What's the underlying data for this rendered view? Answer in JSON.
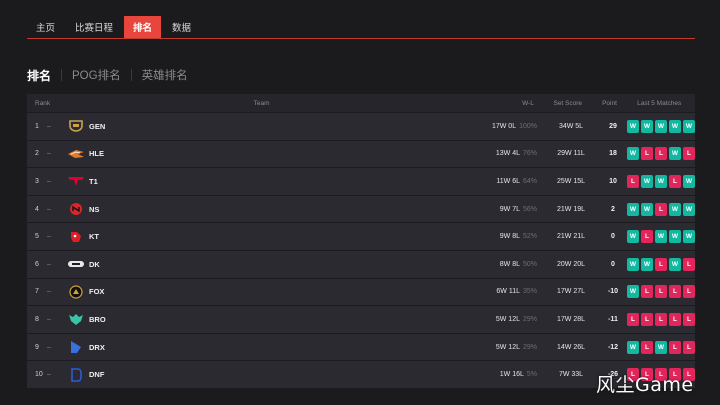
{
  "nav": {
    "items": [
      {
        "label": "主页",
        "active": false
      },
      {
        "label": "比赛日程",
        "active": false
      },
      {
        "label": "排名",
        "active": true
      },
      {
        "label": "数据",
        "active": false
      }
    ]
  },
  "subtabs": [
    "排名",
    "POG排名",
    "英雄排名"
  ],
  "table": {
    "headers": {
      "rank": "Rank",
      "team": "Team",
      "wl": "W-L",
      "set": "Set Score",
      "point": "Point",
      "last5": "Last 5 Matches"
    },
    "rows": [
      {
        "rank": "1",
        "team": "GEN",
        "wl": "17W 0L",
        "pct": "100%",
        "set": "34W 5L",
        "point": "29",
        "last5": [
          "W",
          "W",
          "W",
          "W",
          "W"
        ],
        "logo_color": "#c9a44c"
      },
      {
        "rank": "2",
        "team": "HLE",
        "wl": "13W 4L",
        "pct": "76%",
        "set": "29W 11L",
        "point": "18",
        "last5": [
          "W",
          "L",
          "L",
          "W",
          "L"
        ],
        "logo_color": "#e07a2e"
      },
      {
        "rank": "3",
        "team": "T1",
        "wl": "11W 6L",
        "pct": "64%",
        "set": "25W 15L",
        "point": "10",
        "last5": [
          "L",
          "W",
          "W",
          "L",
          "W"
        ],
        "logo_color": "#e2012d"
      },
      {
        "rank": "4",
        "team": "NS",
        "wl": "9W 7L",
        "pct": "56%",
        "set": "21W 19L",
        "point": "2",
        "last5": [
          "W",
          "W",
          "L",
          "W",
          "W"
        ],
        "logo_color": "#d9262b"
      },
      {
        "rank": "5",
        "team": "KT",
        "wl": "9W 8L",
        "pct": "52%",
        "set": "21W 21L",
        "point": "0",
        "last5": [
          "W",
          "L",
          "W",
          "W",
          "W"
        ],
        "logo_color": "#e01e25"
      },
      {
        "rank": "6",
        "team": "DK",
        "wl": "8W 8L",
        "pct": "50%",
        "set": "20W 20L",
        "point": "0",
        "last5": [
          "W",
          "W",
          "L",
          "W",
          "L"
        ],
        "logo_color": "#e8e8e8"
      },
      {
        "rank": "7",
        "team": "FOX",
        "wl": "6W 11L",
        "pct": "35%",
        "set": "17W 27L",
        "point": "-10",
        "last5": [
          "W",
          "L",
          "L",
          "L",
          "L"
        ],
        "logo_color": "#d2a23a"
      },
      {
        "rank": "8",
        "team": "BRO",
        "wl": "5W 12L",
        "pct": "29%",
        "set": "17W 28L",
        "point": "-11",
        "last5": [
          "L",
          "L",
          "L",
          "L",
          "L"
        ],
        "logo_color": "#39c4a8"
      },
      {
        "rank": "9",
        "team": "DRX",
        "wl": "5W 12L",
        "pct": "29%",
        "set": "14W 26L",
        "point": "-12",
        "last5": [
          "W",
          "L",
          "W",
          "L",
          "L"
        ],
        "logo_color": "#3a6fe0"
      },
      {
        "rank": "10",
        "team": "DNF",
        "wl": "1W 16L",
        "pct": "5%",
        "set": "7W 33L",
        "point": "-26",
        "last5": [
          "L",
          "L",
          "L",
          "L",
          "L"
        ],
        "logo_color": "#2d5ad6"
      }
    ]
  },
  "watermark": "风尘Game"
}
